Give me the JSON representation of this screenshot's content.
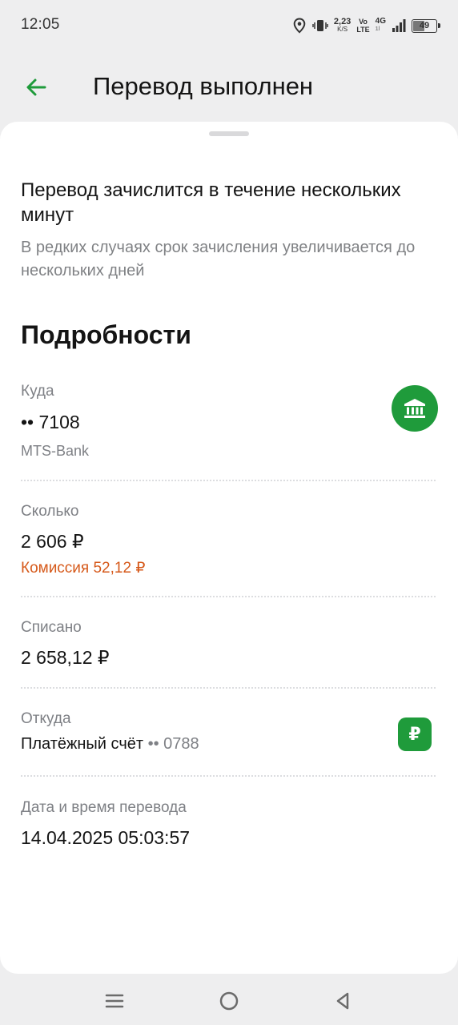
{
  "status_bar": {
    "time": "12:05",
    "net_speed": "2,23",
    "net_speed_unit": "K/S",
    "volte_top": "Vo",
    "volte_bottom": "LTE",
    "network_type": "4G",
    "network_sub": "1l",
    "battery": "49"
  },
  "header": {
    "title": "Перевод выполнен",
    "back_icon": "arrow-left-icon",
    "accent_color": "#1f9b3b"
  },
  "info": {
    "title": "Перевод зачислится в течение нескольких минут",
    "subtitle": "В редких случаях срок зачисления увеличивается до нескольких дней"
  },
  "details": {
    "title": "Подробности",
    "to": {
      "label": "Куда",
      "value": "•• 7108",
      "bank": "MTS-Bank",
      "icon": "bank-icon"
    },
    "amount": {
      "label": "Сколько",
      "value": "2 606 ₽",
      "fee": "Комиссия 52,12 ₽",
      "fee_color": "#d6591a"
    },
    "debited": {
      "label": "Списано",
      "value": "2 658,12 ₽"
    },
    "from": {
      "label": "Откуда",
      "account": "Платёжный счёт",
      "mask": "•• 0788",
      "icon_glyph": "₽"
    },
    "datetime": {
      "label": "Дата и время перевода",
      "value": "14.04.2025 05:03:57"
    }
  },
  "nav_bar": {
    "menu_icon": "menu-icon",
    "home_icon": "home-circle-icon",
    "back_icon": "back-triangle-icon"
  }
}
